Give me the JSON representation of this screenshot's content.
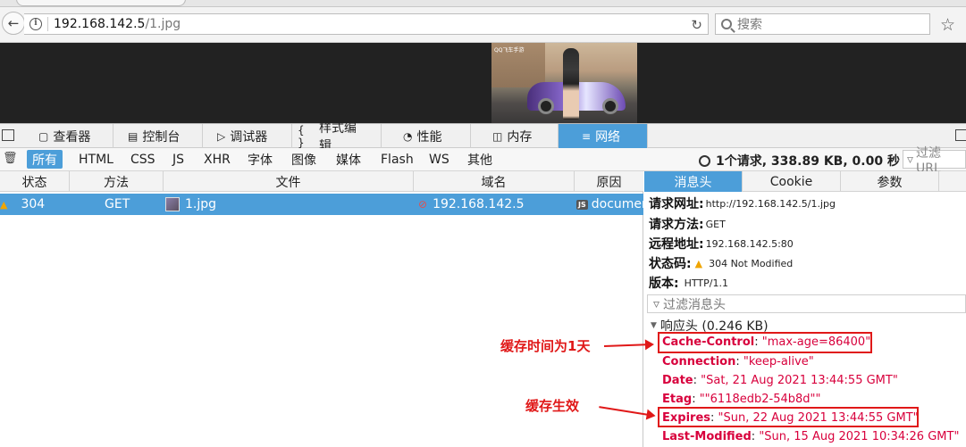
{
  "browser": {
    "url_host": "192.168.142.5",
    "url_path": "/1.jpg",
    "search_placeholder": "搜索"
  },
  "page_image": {
    "logo_text": "QQ飞车手游"
  },
  "devtools": {
    "tabs": [
      {
        "icon": "inspector-icon",
        "label": "查看器"
      },
      {
        "icon": "console-icon",
        "label": "控制台"
      },
      {
        "icon": "debugger-icon",
        "label": "调试器"
      },
      {
        "icon": "style-editor-icon",
        "label": "样式编辑..."
      },
      {
        "icon": "performance-icon",
        "label": "性能"
      },
      {
        "icon": "memory-icon",
        "label": "内存"
      },
      {
        "icon": "network-icon",
        "label": "网络"
      }
    ],
    "active_tab": "网络",
    "filter_types": [
      "所有",
      "HTML",
      "CSS",
      "JS",
      "XHR",
      "字体",
      "图像",
      "媒体",
      "Flash",
      "WS",
      "其他"
    ],
    "summary": "1个请求, 338.89 KB, 0.00 秒",
    "filter_url_placeholder": "过滤 URL"
  },
  "request_table": {
    "columns": [
      "状态",
      "方法",
      "文件",
      "域名",
      "原因"
    ],
    "rows": [
      {
        "status": "304",
        "method": "GET",
        "file": "1.jpg",
        "domain": "192.168.142.5",
        "cause": "document"
      }
    ]
  },
  "details": {
    "tabs": [
      "消息头",
      "Cookie",
      "参数"
    ],
    "request_url_label": "请求网址:",
    "request_url": "http://192.168.142.5/1.jpg",
    "request_method_label": "请求方法:",
    "request_method": "GET",
    "remote_addr_label": "远程地址:",
    "remote_addr": "192.168.142.5:80",
    "status_code_label": "状态码:",
    "status_code": "304  Not  Modified",
    "version_label": "版本:",
    "version": "HTTP/1.1",
    "filter_headers_placeholder": "过滤消息头",
    "response_headers_label": "响应头 (0.246 KB)",
    "response_headers": [
      {
        "name": "Cache-Control",
        "value": "\"max-age=86400\""
      },
      {
        "name": "Connection",
        "value": "\"keep-alive\""
      },
      {
        "name": "Date",
        "value": "\"Sat, 21 Aug 2021 13:44:55 GMT\""
      },
      {
        "name": "Etag",
        "value": "\"\"6118edb2-54b8d\"\""
      },
      {
        "name": "Expires",
        "value": "\"Sun, 22 Aug 2021 13:44:55 GMT\""
      },
      {
        "name": "Last-Modified",
        "value": "\"Sun, 15 Aug 2021 10:34:26 GMT\""
      }
    ]
  },
  "annotations": {
    "cache_time": "缓存时间为1天",
    "cache_effective": "缓存生效"
  }
}
